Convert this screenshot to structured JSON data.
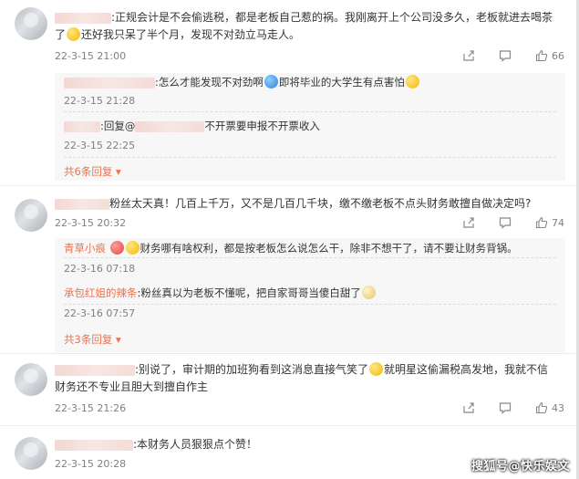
{
  "comments": [
    {
      "text_a": ":正规会计是不会偷逃税，都是老板自己惹的祸。我刚离开上个公司没多久，老板就进去喝茶",
      "text_b": "了",
      "text_c": "还好我只呆了半个月，发现不对劲立马走人。",
      "time": "22-3-15 21:00",
      "likes": "66",
      "replies": [
        {
          "text_a": ":怎么才能发现不对劲啊",
          "text_b": "即将毕业的大学生有点害怕",
          "time": "22-3-15 21:28"
        },
        {
          "text_a": ":回复@",
          "text_b": "不开票要申报不开票收入",
          "time": "22-3-15 22:25"
        }
      ],
      "more": "共6条回复"
    },
    {
      "text": "粉丝太天真！几百上千万，又不是几百几千块，缴不缴老板不点头财务敢擅自做决定吗?",
      "time": "22-3-15 20:32",
      "likes": "74",
      "replies": [
        {
          "user": "青草小痕",
          "text": "财务哪有啥权利，都是按老板怎么说怎么干，除非不想干了，请不要让财务背锅。",
          "time": "22-3-16 07:18"
        },
        {
          "user": "承包红姐的辣条",
          "text": ":粉丝真以为老板不懂呢，把自家哥哥当傻白甜了",
          "time": "22-3-16 07:57"
        }
      ],
      "more": "共3条回复"
    },
    {
      "text_a": ":别说了，审计期的加班狗看到这消息直接气笑了",
      "text_b": "就明星这偷漏税高发地，我就不信",
      "text_c": "财务还不专业且胆大到擅自作主",
      "time": "22-3-15 21:26",
      "likes": "43"
    },
    {
      "text": ":本财务人员狠狠点个赞！",
      "time": "22-3-15 20:28"
    }
  ],
  "watermark": "搜狐号@快乐娱文",
  "icons": {
    "share": "share-icon",
    "comment": "comment-icon",
    "like": "thumbs-up-icon"
  }
}
